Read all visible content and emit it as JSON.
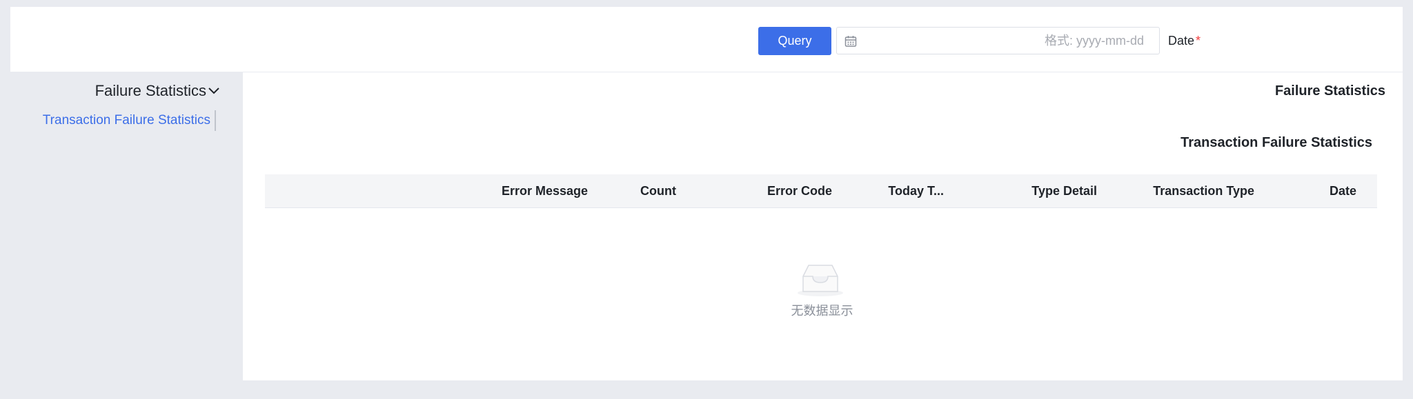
{
  "filter": {
    "date_label": "Date",
    "required_mark": "*",
    "date_placeholder": "格式: yyyy-mm-dd",
    "date_value": "",
    "query_button": "Query"
  },
  "sidebar": {
    "group_title": "Failure Statistics",
    "items": [
      {
        "label": "Transaction Failure Statistics",
        "active": true
      }
    ]
  },
  "main": {
    "title": "Failure Statistics",
    "section_title": "Transaction Failure Statistics",
    "table": {
      "columns": [
        "Date",
        "Transaction Type",
        "Type Detail",
        "Today T...",
        "Error Code",
        "Count",
        "Error Message"
      ],
      "rows": []
    },
    "empty_text": "无数据显示"
  },
  "colors": {
    "accent": "#3c6ee8",
    "required": "#f23c3c",
    "page_bg": "#e9ebf0",
    "header_bg": "#f4f5f7"
  },
  "icons": {
    "calendar": "calendar-icon",
    "chevron": "chevron-down-icon",
    "empty": "empty-inbox-icon"
  }
}
